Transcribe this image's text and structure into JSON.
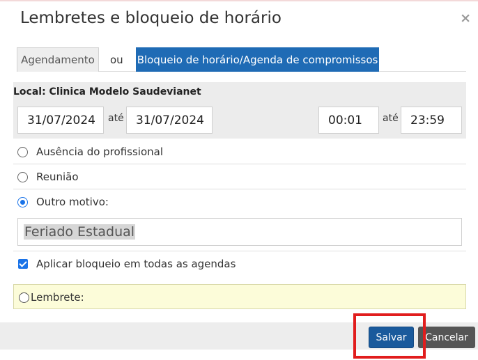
{
  "dialog": {
    "title": "Lembretes e bloqueio de horário",
    "close_glyph": "×"
  },
  "tabs": {
    "agendamento": "Agendamento",
    "separator": "ou",
    "bloqueio": "Bloqueio de horário/Agenda de compromissos",
    "active": "bloqueio"
  },
  "local": {
    "label": "Local: Clinica Modelo Saudevianet"
  },
  "period": {
    "date_start": "31/07/2024",
    "date_end": "31/07/2024",
    "time_start": "00:01",
    "time_end": "23:59",
    "ate_label": "até"
  },
  "reasons": {
    "options": [
      {
        "label": "Ausência do profissional",
        "checked": false
      },
      {
        "label": "Reunião",
        "checked": false
      },
      {
        "label": "Outro motivo:",
        "checked": true
      }
    ],
    "other_value": "Feriado Estadual"
  },
  "apply_all": {
    "label": "Aplicar bloqueio em todas as agendas",
    "checked": true
  },
  "lembrete": {
    "label": "Lembrete:",
    "checked": false
  },
  "footer": {
    "save_label": "Salvar",
    "cancel_label": "Cancelar"
  },
  "colors": {
    "active_tab": "#1f6bb5",
    "save_button": "#1a5a9c",
    "cancel_button": "#555555",
    "lembrete_bg": "#fcfcd9",
    "highlight_border": "#e11d1d"
  }
}
